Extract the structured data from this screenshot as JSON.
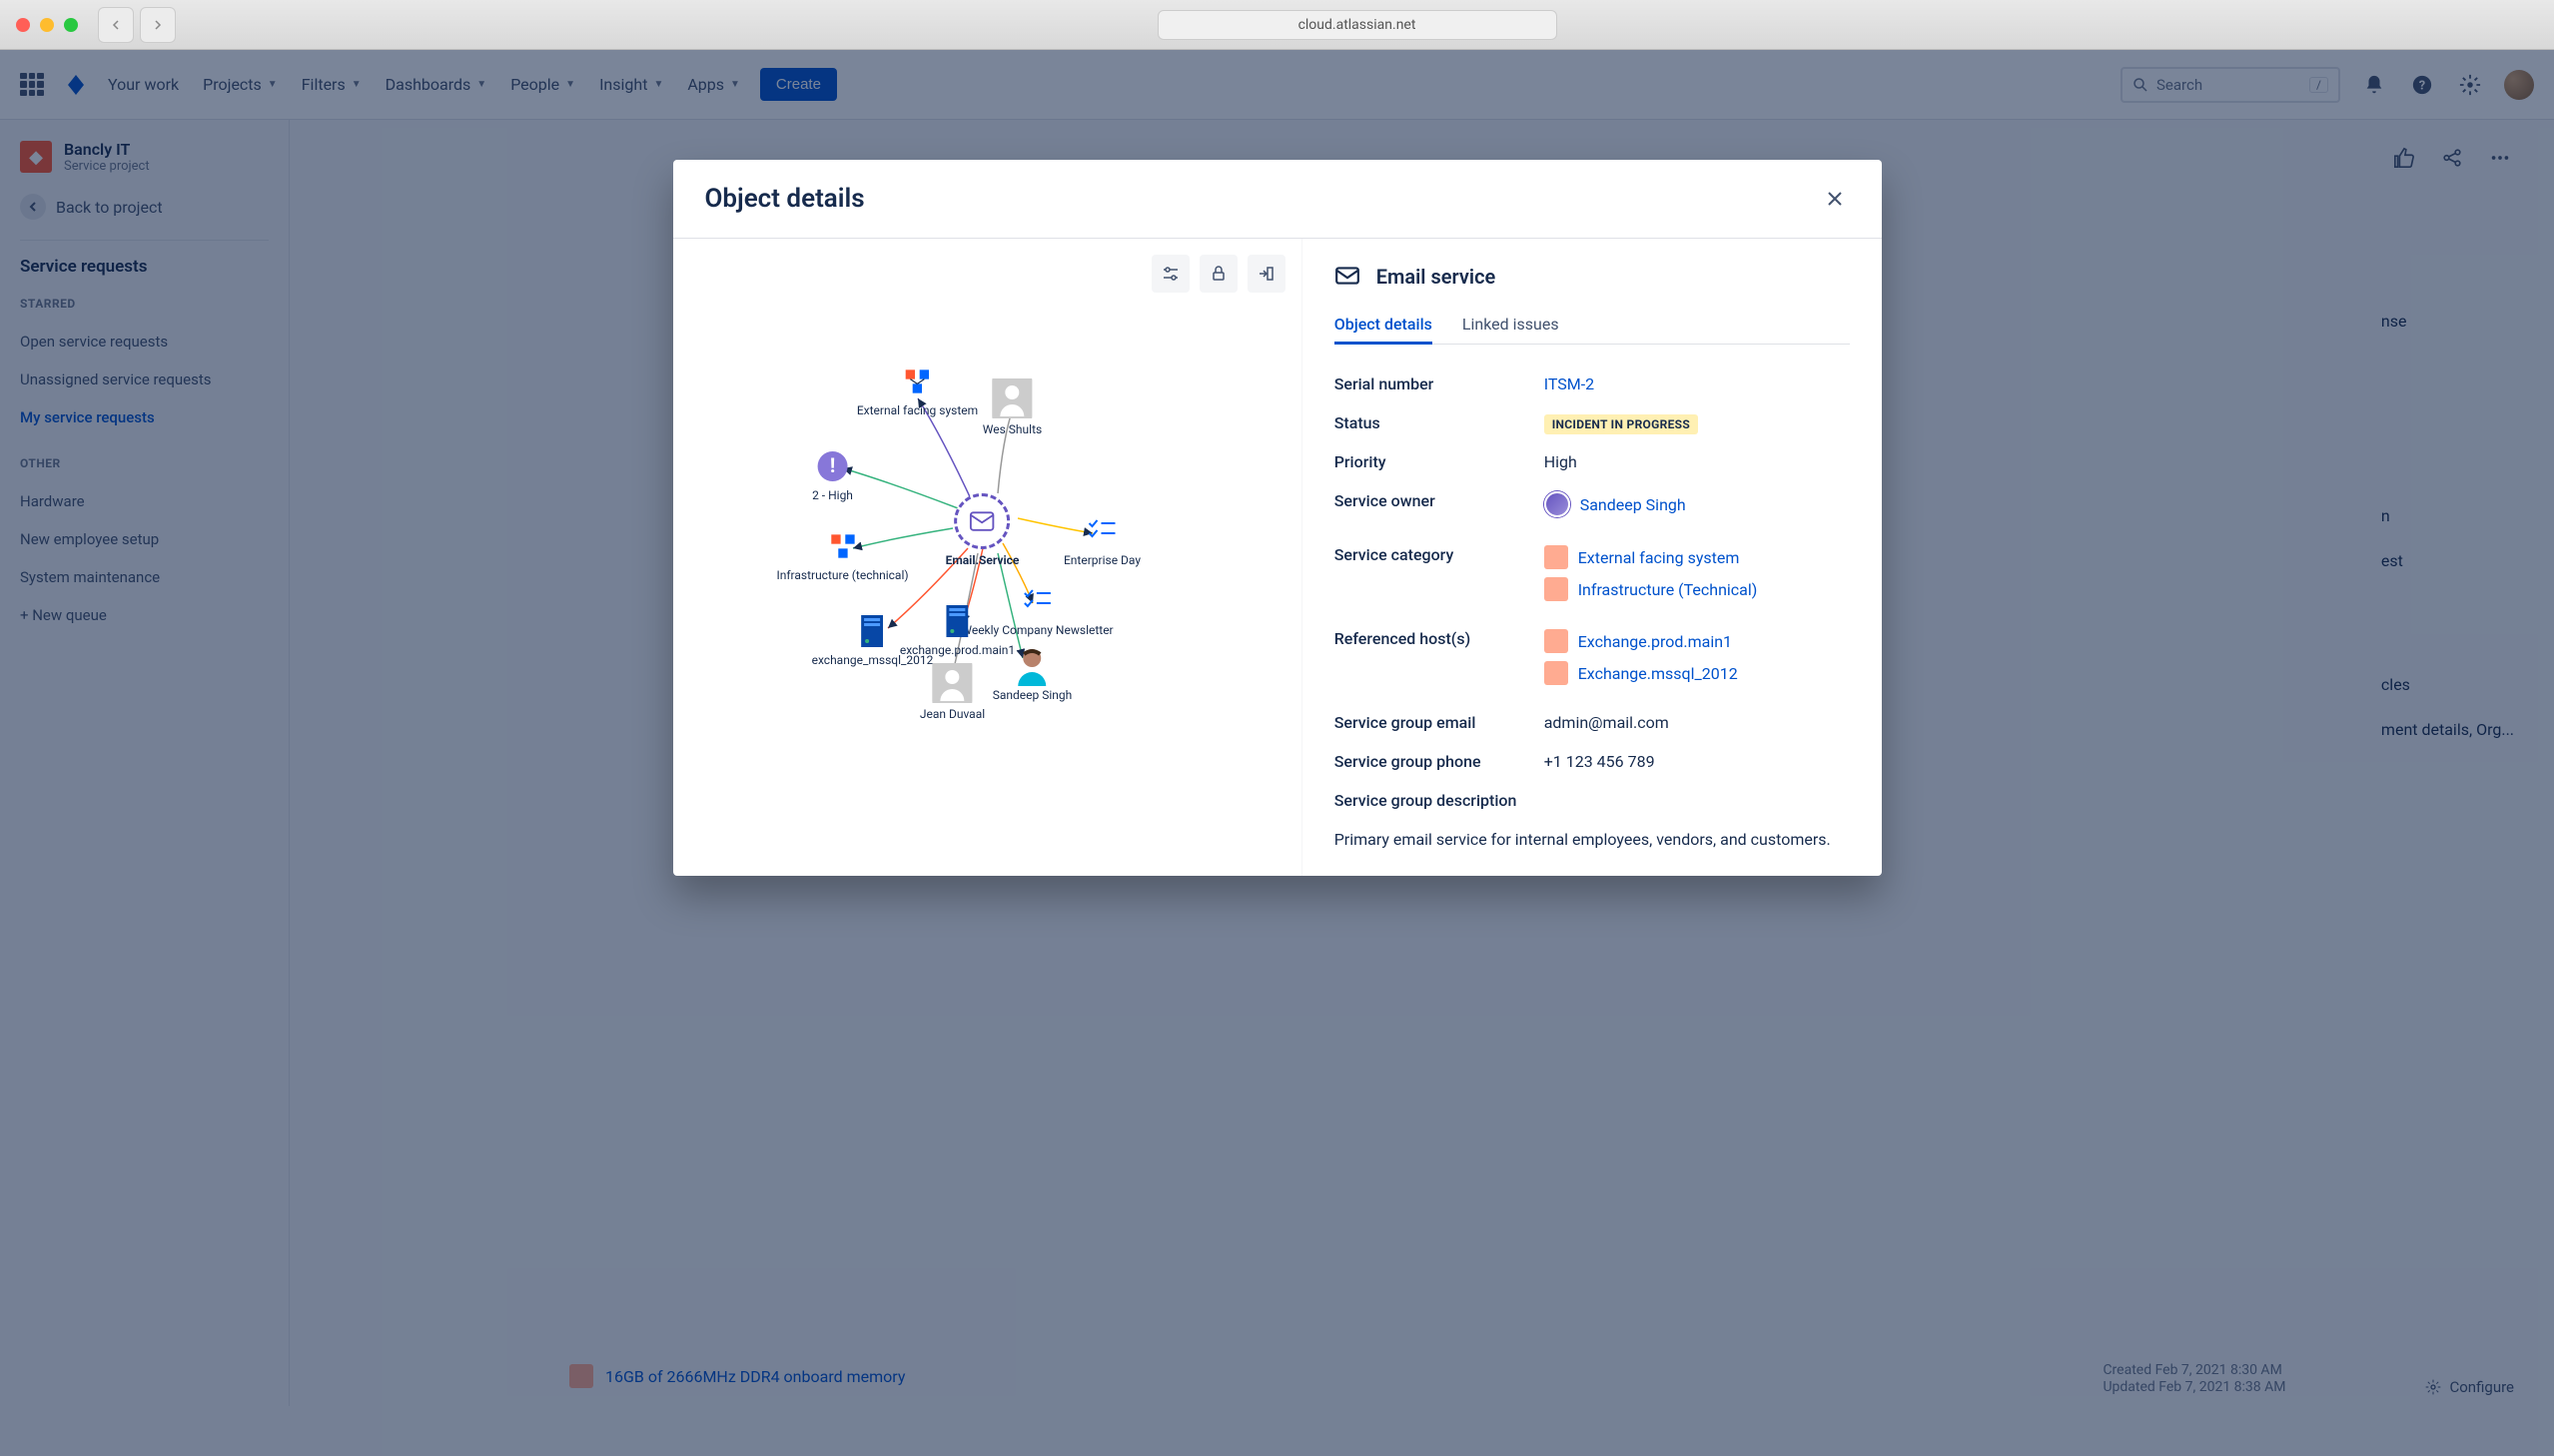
{
  "browser": {
    "url": "cloud.atlassian.net"
  },
  "topnav": {
    "items": [
      "Your work",
      "Projects",
      "Filters",
      "Dashboards",
      "People",
      "Insight",
      "Apps"
    ],
    "create": "Create",
    "search_placeholder": "Search",
    "search_key": "/"
  },
  "project": {
    "name": "Bancly IT",
    "type": "Service project",
    "back": "Back to project"
  },
  "sidebar": {
    "heading": "Service requests",
    "starred_label": "STARRED",
    "starred": [
      "Open service requests",
      "Unassigned service requests",
      "My service requests"
    ],
    "active_index": 2,
    "other_label": "OTHER",
    "other": [
      "Hardware",
      "New employee setup",
      "System maintenance",
      "+ New queue"
    ]
  },
  "modal": {
    "title": "Object details",
    "object_name": "Email service",
    "tabs": [
      "Object details",
      "Linked issues"
    ],
    "graph_nodes": {
      "center": "Email.Service",
      "external": "External facing system",
      "wes": "Wes Shults",
      "priority": "2 - High",
      "infra": "Infrastructure (technical)",
      "enterprise": "Enterprise Day",
      "newsletter": "Weekly Company Newsletter",
      "exchange_main": "exchange.prod.main1",
      "exchange_mssql": "exchange_mssql_2012",
      "jean": "Jean Duvaal",
      "sandeep": "Sandeep Singh"
    },
    "details": {
      "serial_label": "Serial number",
      "serial": "ITSM-2",
      "status_label": "Status",
      "status": "INCIDENT IN PROGRESS",
      "priority_label": "Priority",
      "priority": "High",
      "owner_label": "Service owner",
      "owner": "Sandeep Singh",
      "category_label": "Service category",
      "categories": [
        "External facing system",
        "Infrastructure (Technical)"
      ],
      "hosts_label": "Referenced host(s)",
      "hosts": [
        "Exchange.prod.main1",
        "Exchange.mssql_2012"
      ],
      "email_label": "Service group email",
      "email": "admin@mail.com",
      "phone_label": "Service group phone",
      "phone": "+1 123 456 789",
      "desc_label": "Service group description",
      "description": "Primary email service for internal employees, vendors, and customers."
    }
  },
  "background": {
    "right_snippets": [
      "nse",
      "n",
      "est",
      "cles",
      "ment details, Org..."
    ],
    "item": "16GB of 2666MHz DDR4 onboard memory",
    "created": "Created Feb 7, 2021 8:30 AM",
    "updated": "Updated Feb 7, 2021 8:38 AM",
    "configure": "Configure"
  }
}
